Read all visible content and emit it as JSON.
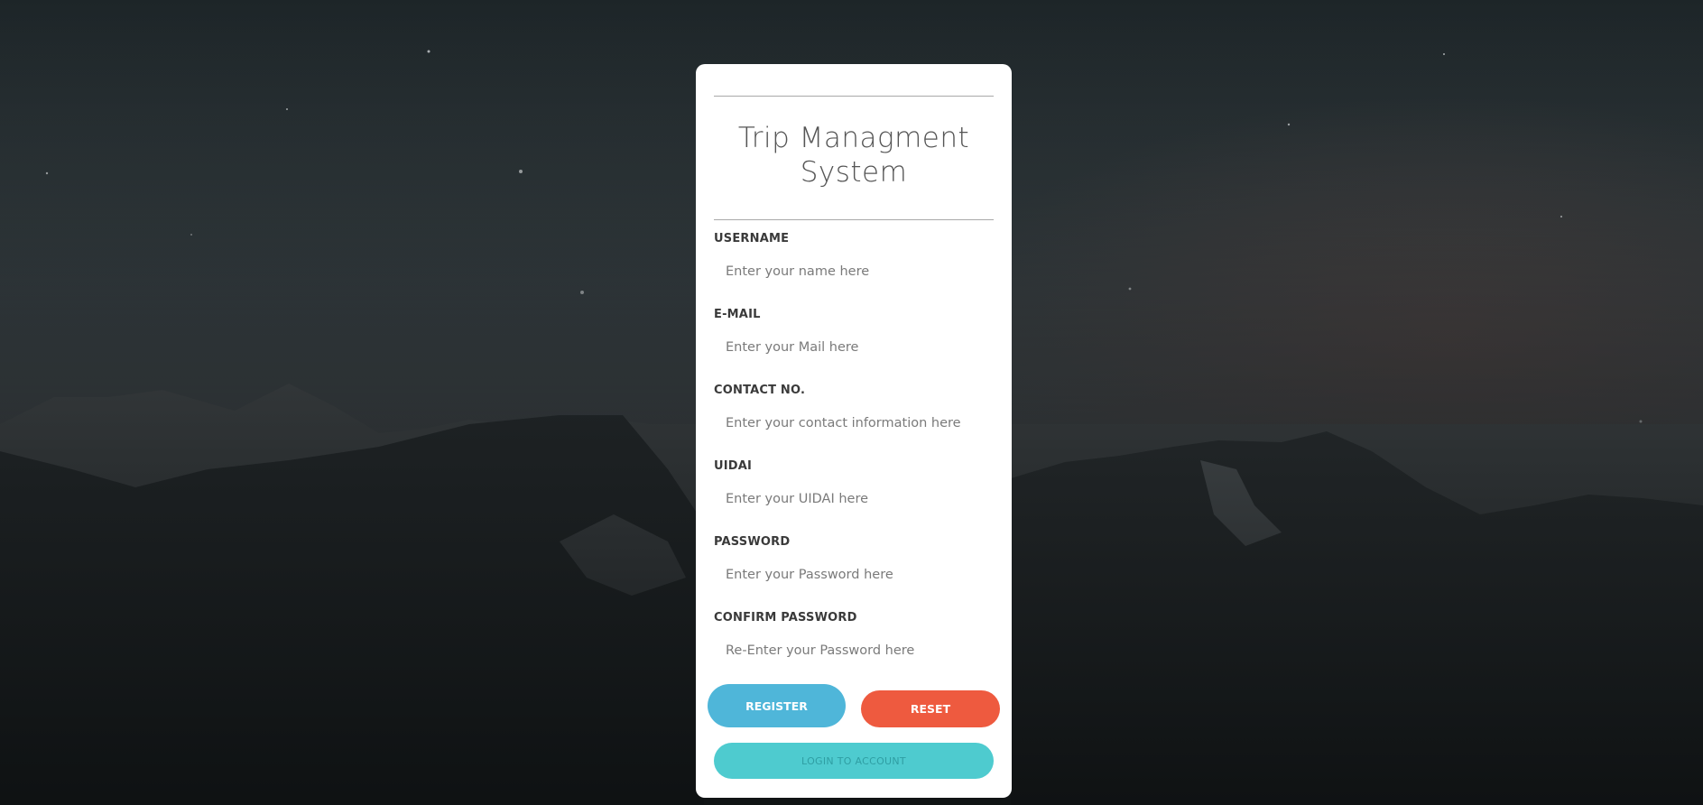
{
  "app": {
    "title": "Trip Managment System"
  },
  "form": {
    "fields": [
      {
        "label": "USERNAME",
        "placeholder": "Enter your name here"
      },
      {
        "label": "E-MAIL",
        "placeholder": "Enter your Mail here"
      },
      {
        "label": "CONTACT NO.",
        "placeholder": "Enter your contact information here"
      },
      {
        "label": "UIDAI",
        "placeholder": "Enter your UIDAI here"
      },
      {
        "label": "PASSWORD",
        "placeholder": "Enter your Password here"
      },
      {
        "label": "CONFIRM PASSWORD",
        "placeholder": "Re-Enter your Password here"
      }
    ]
  },
  "buttons": {
    "register": "REGISTER",
    "reset": "RESET",
    "login": "LOGIN TO ACCOUNT"
  },
  "colors": {
    "register": "#4fb6d9",
    "reset": "#ee5a3f",
    "login": "#4ecbcf",
    "card": "#ffffff"
  }
}
